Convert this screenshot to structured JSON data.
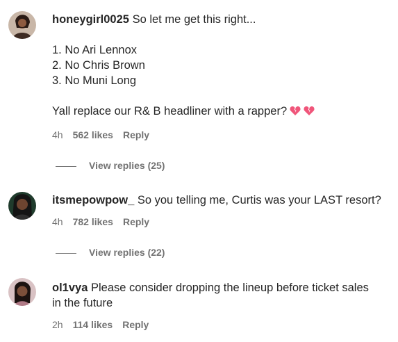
{
  "comments": [
    {
      "username": "honeygirl0025",
      "lines": [
        "So let me get this right...",
        "",
        "1. No Ari Lennox",
        "2. No Chris Brown",
        "3. No Muni Long",
        "",
        "Yall replace our R& B headliner with a rapper?"
      ],
      "trailing_icons": [
        "broken-heart-icon",
        "broken-heart-icon"
      ],
      "time": "4h",
      "likes": "562 likes",
      "reply_label": "Reply",
      "view_replies": "View replies (25)"
    },
    {
      "username": "itsmepowpow_",
      "lines": [
        "So you telling me, Curtis was your LAST resort?"
      ],
      "time": "4h",
      "likes": "782 likes",
      "reply_label": "Reply",
      "view_replies": "View replies (22)"
    },
    {
      "username": "ol1vya",
      "lines": [
        "Please consider dropping the lineup before ticket sales",
        "in the future"
      ],
      "time": "2h",
      "likes": "114 likes",
      "reply_label": "Reply"
    }
  ],
  "colors": {
    "text": "#262626",
    "meta": "#737373",
    "heart": "#f0557a"
  }
}
